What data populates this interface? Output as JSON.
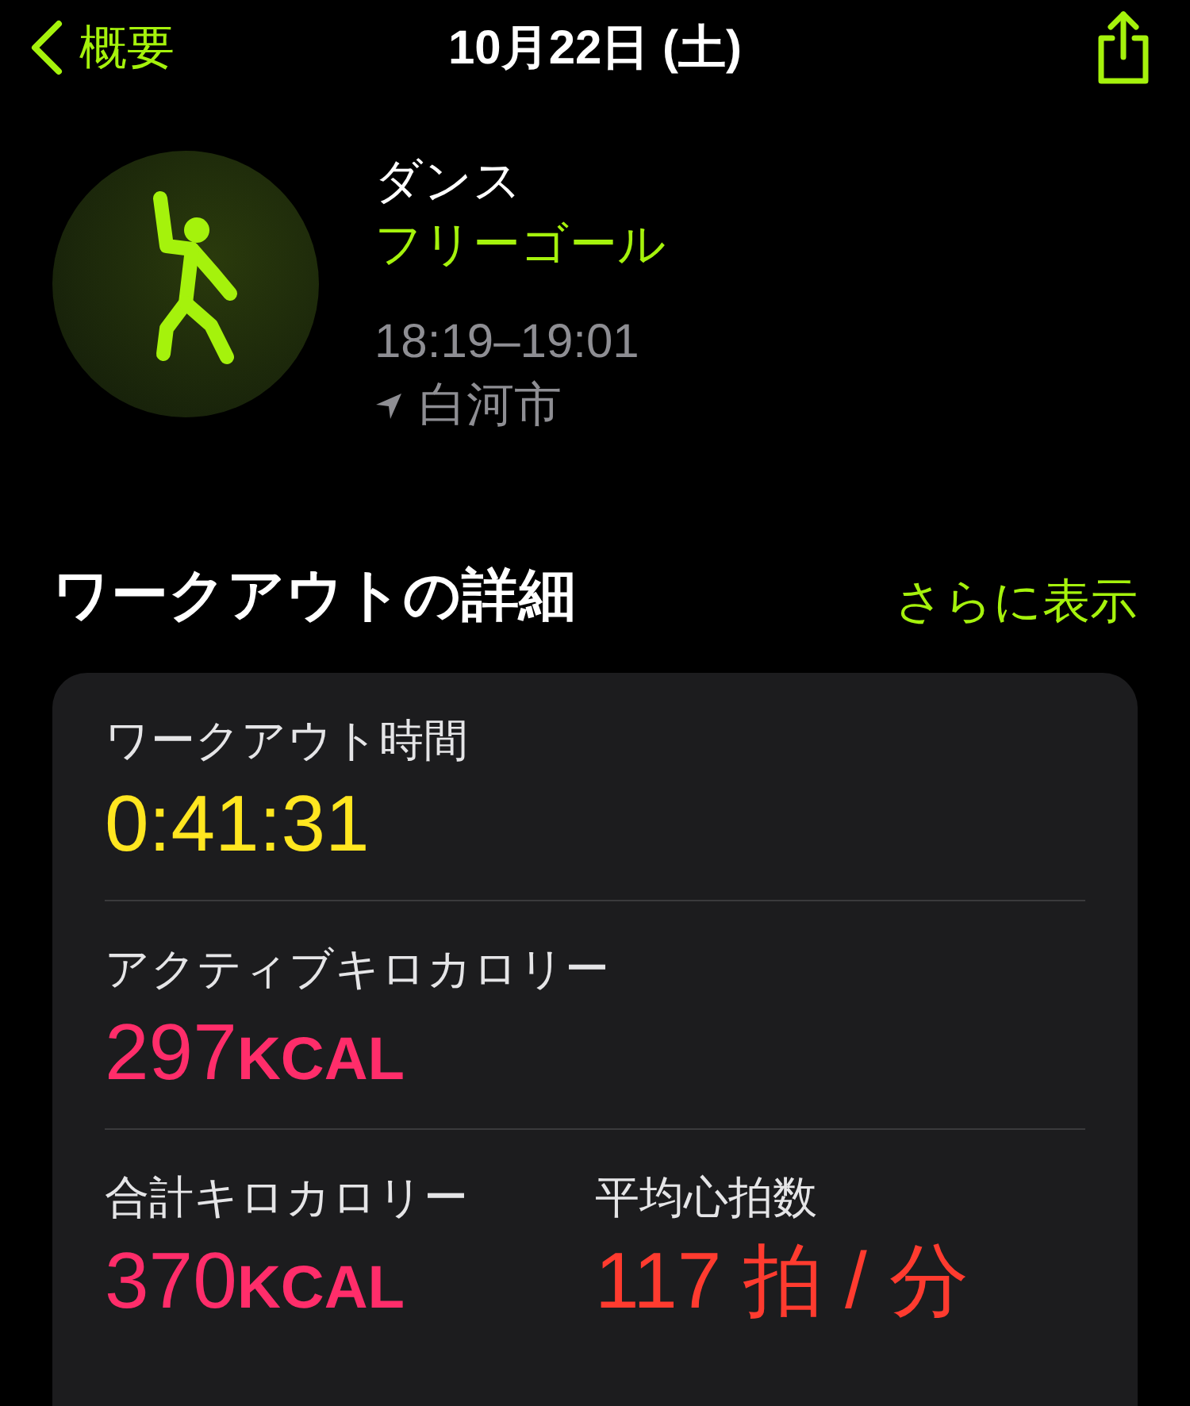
{
  "nav": {
    "back": "概要",
    "title": "10月22日 (土)"
  },
  "workout": {
    "type": "ダンス",
    "goal": "フリーゴール",
    "time": "18:19–19:01",
    "location": "白河市"
  },
  "section": {
    "title": "ワークアウトの詳細",
    "more": "さらに表示"
  },
  "rows": [
    {
      "items": [
        {
          "label": "ワークアウト時間",
          "value": "0:41:31",
          "color": "#ffe620"
        }
      ]
    },
    {
      "items": [
        {
          "label": "アクティブキロカロリー",
          "value": "297",
          "unit": "KCAL",
          "color": "#ff2d6a"
        }
      ]
    },
    {
      "items": [
        {
          "label": "合計キロカロリー",
          "value": "370",
          "unit": "KCAL",
          "color": "#ff2d6a"
        },
        {
          "label": "平均心拍数",
          "value": "117 拍 / 分",
          "color": "#ff3b2f"
        }
      ]
    }
  ]
}
